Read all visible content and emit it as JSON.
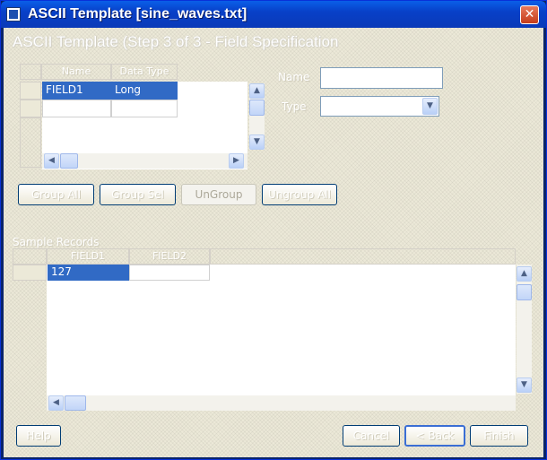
{
  "window": {
    "title": "ASCII Template [sine_waves.txt]",
    "close_glyph": "✕"
  },
  "step_heading": "ASCII Template (Step 3 of 3 - Field Specification",
  "field_grid": {
    "columns": [
      "Name",
      "Data Type"
    ],
    "rows": [
      [
        "FIELD1",
        "Long"
      ],
      [
        "",
        ""
      ]
    ]
  },
  "field_props": {
    "name_label": "Name",
    "type_label": "Type",
    "name_value": "",
    "type_value": ""
  },
  "group_buttons": [
    "Group All",
    "Group Sel",
    "UnGroup",
    "Ungroup All"
  ],
  "sample_section": {
    "label": "Sample Records",
    "columns": [
      "FIELD1",
      "FIELD2"
    ],
    "rows": [
      [
        "127",
        ""
      ]
    ]
  },
  "footer_buttons": {
    "help": "Help",
    "cancel": "Cancel",
    "back": "< Back",
    "finish": "Finish"
  },
  "icons": {
    "up": "▲",
    "down": "▼",
    "left": "◀",
    "right": "▶",
    "combo": "▼"
  }
}
